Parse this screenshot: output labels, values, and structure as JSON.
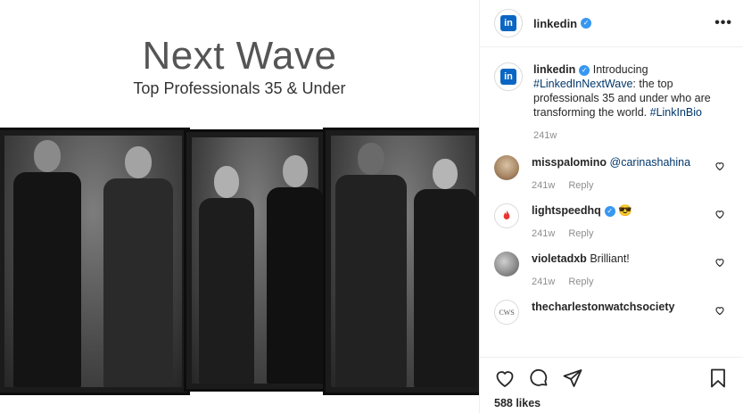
{
  "photo": {
    "title": "Next Wave",
    "subtitle": "Top Professionals 35 & Under"
  },
  "post": {
    "account": "linkedin",
    "more_label": "•••",
    "caption": {
      "username": "linkedin",
      "lead": "Introducing",
      "hashtag": "#LinkedInNextWave",
      "text": ": the top professionals 35 and under who are transforming the world.",
      "tag2": "#LinkInBio",
      "time": "241w"
    },
    "comments": [
      {
        "username": "misspalomino",
        "text": "@carinashahina",
        "time": "241w",
        "reply": "Reply"
      },
      {
        "username": "lightspeedhq",
        "text": "😎",
        "time": "241w",
        "reply": "Reply"
      },
      {
        "username": "violetadxb",
        "text": "Brilliant!",
        "time": "241w",
        "reply": "Reply"
      },
      {
        "username": "thecharlestonwatchsociety",
        "avatar_text": "CWS"
      }
    ],
    "likes": "588 likes"
  }
}
